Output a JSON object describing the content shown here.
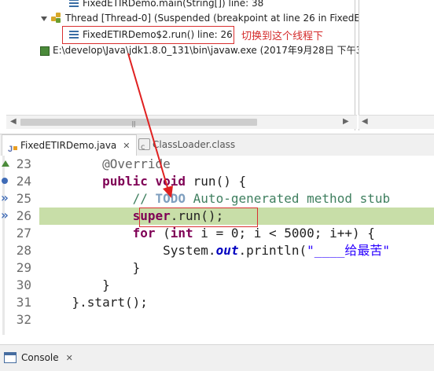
{
  "debug_view": {
    "frames": [
      {
        "label": "FixedETIRDemo.main(String[]) line: 38",
        "icon": "stack-frame-icon"
      },
      {
        "label": "Thread [Thread-0] (Suspended (breakpoint at line 26 in FixedE",
        "icon": "thread-icon"
      },
      {
        "label": "FixedETIRDemo$2.run() line: 26",
        "icon": "stack-frame-icon",
        "selected": true
      },
      {
        "label": "E:\\develop\\Java\\jdk1.8.0_131\\bin\\javaw.exe (2017年9月28日 下午3",
        "icon": "process-icon"
      }
    ],
    "annotation": "切换到这个线程下",
    "annotation_color": "#d42a2a"
  },
  "tabs": [
    {
      "label": "FixedETIRDemo.java",
      "icon": "java-file-icon",
      "active": true
    },
    {
      "label": "ClassLoader.class",
      "icon": "class-file-icon",
      "active": false
    }
  ],
  "editor": {
    "lines": [
      {
        "n": "23",
        "parts": [
          {
            "t": "        "
          },
          {
            "t": "@Override",
            "c": "ann"
          }
        ]
      },
      {
        "n": "24",
        "parts": [
          {
            "t": "        "
          },
          {
            "t": "public",
            "c": "kw"
          },
          {
            "t": " "
          },
          {
            "t": "void",
            "c": "kw"
          },
          {
            "t": " run() {"
          }
        ]
      },
      {
        "n": "25",
        "parts": [
          {
            "t": "            "
          },
          {
            "t": "// ",
            "c": "cm"
          },
          {
            "t": "TODO",
            "c": "tdo"
          },
          {
            "t": " Auto-generated method stub",
            "c": "cm"
          }
        ]
      },
      {
        "n": "26",
        "parts": [
          {
            "t": "            "
          },
          {
            "t": "super",
            "c": "kw"
          },
          {
            "t": ".run();"
          }
        ],
        "current": true
      },
      {
        "n": "27",
        "parts": [
          {
            "t": "            "
          },
          {
            "t": "for",
            "c": "kw"
          },
          {
            "t": " ("
          },
          {
            "t": "int",
            "c": "kw"
          },
          {
            "t": " i = 0; i < 5000; i++) {"
          }
        ]
      },
      {
        "n": "28",
        "parts": [
          {
            "t": "                System."
          },
          {
            "t": "out",
            "c": "fld"
          },
          {
            "t": ".println("
          },
          {
            "t": "\"____给最苦\"",
            "c": "str"
          }
        ]
      },
      {
        "n": "29",
        "parts": [
          {
            "t": "            }"
          }
        ]
      },
      {
        "n": "30",
        "parts": [
          {
            "t": "        }"
          }
        ]
      },
      {
        "n": "31",
        "parts": [
          {
            "t": "    }.start();"
          }
        ]
      },
      {
        "n": "32",
        "parts": [
          {
            "t": ""
          }
        ]
      }
    ],
    "current_line_color": "#c8dea8"
  },
  "console_tab": {
    "label": "Console",
    "icon": "console-icon"
  },
  "colors": {
    "keyword": "#7f0055",
    "comment": "#3f7f5f",
    "string": "#2a00ff",
    "highlight_box": "#d93030"
  }
}
